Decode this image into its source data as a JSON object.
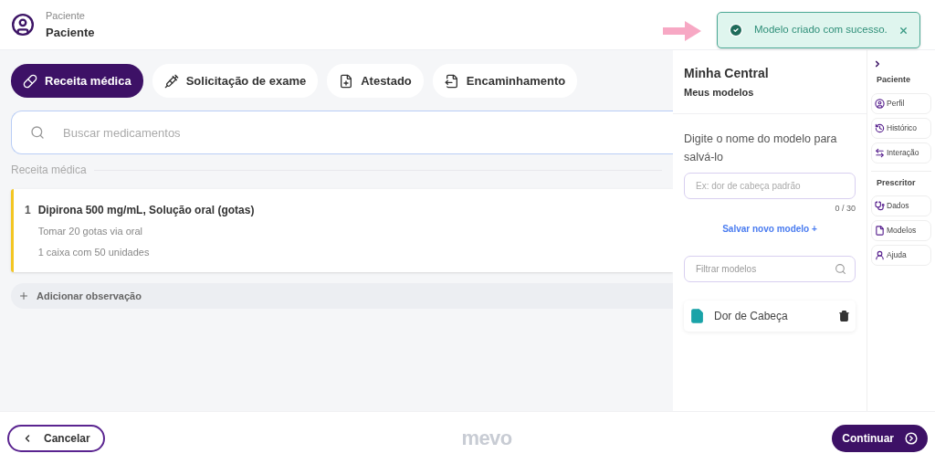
{
  "header": {
    "label": "Paciente",
    "name": "Paciente"
  },
  "toast": {
    "message": "Modelo criado com sucesso."
  },
  "tabs": [
    {
      "label": "Receita médica",
      "kind": "pills",
      "selected": true
    },
    {
      "label": "Solicitação de exame",
      "kind": "syringe",
      "selected": false
    },
    {
      "label": "Atestado",
      "kind": "file-plus",
      "selected": false
    },
    {
      "label": "Encaminhamento",
      "kind": "file-arrow",
      "selected": false
    }
  ],
  "search": {
    "placeholder": "Buscar medicamentos"
  },
  "section_title": "Receita médica",
  "prescriptions": [
    {
      "number": "1",
      "name": "Dipirona 500 mg/mL, Solução oral (gotas)",
      "dosage": "Tomar 20 gotas via oral",
      "quantity": "1 caixa com 50 unidades"
    }
  ],
  "add_note": "Adicionar observação",
  "panel": {
    "title": "Minha Central",
    "subtitle": "Meus modelos",
    "prompt": "Digite o nome do modelo para salvá-lo",
    "name_placeholder": "Ex: dor de cabeça padrão",
    "counter": "0 / 30",
    "save_link": "Salvar novo modelo +",
    "filter_placeholder": "Filtrar modelos",
    "models": [
      {
        "name": "Dor de Cabeça"
      }
    ]
  },
  "sidebar": [
    {
      "title": "Paciente",
      "items": [
        {
          "label": "Perfil",
          "kind": "profile"
        },
        {
          "label": "Histórico",
          "kind": "history"
        },
        {
          "label": "Interação",
          "kind": "swap"
        }
      ]
    },
    {
      "title": "Prescritor",
      "items": [
        {
          "label": "Dados",
          "kind": "stethoscope"
        },
        {
          "label": "Modelos",
          "kind": "file"
        },
        {
          "label": "Ajuda",
          "kind": "help"
        }
      ]
    }
  ],
  "footer": {
    "cancel": "Cancelar",
    "logo": "mevo",
    "continue": "Continuar"
  }
}
